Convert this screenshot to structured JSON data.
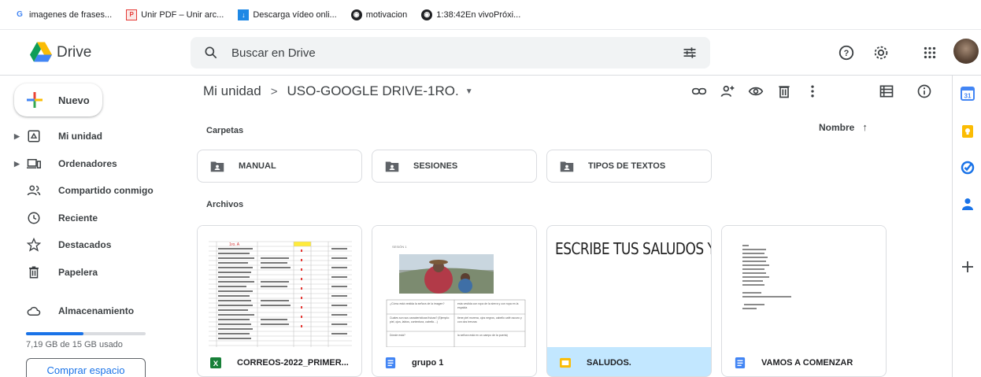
{
  "bookmarks": [
    {
      "label": "imagenes de frases...",
      "icon": "google-g-icon"
    },
    {
      "label": "Unir PDF – Unir arc...",
      "icon": "pdf-icon"
    },
    {
      "label": "Descarga vídeo onli...",
      "icon": "download-icon"
    },
    {
      "label": "motivacion",
      "icon": "globe-icon"
    },
    {
      "label": "1:38:42En vivoPróxi...",
      "icon": "globe-icon"
    }
  ],
  "header": {
    "app_name": "Drive",
    "search_placeholder": "Buscar en Drive"
  },
  "sidebar": {
    "new_label": "Nuevo",
    "items": [
      {
        "label": "Mi unidad",
        "icon": "drive-icon"
      },
      {
        "label": "Ordenadores",
        "icon": "computer-icon"
      },
      {
        "label": "Compartido conmigo",
        "icon": "people-icon"
      },
      {
        "label": "Reciente",
        "icon": "clock-icon"
      },
      {
        "label": "Destacados",
        "icon": "star-icon"
      },
      {
        "label": "Papelera",
        "icon": "trash-icon"
      },
      {
        "label": "Almacenamiento",
        "icon": "cloud-icon"
      }
    ],
    "storage_text": "7,19 GB de 15 GB usado",
    "storage_fraction": 0.48,
    "buy_label": "Comprar espacio"
  },
  "main": {
    "breadcrumb_root": "Mi unidad",
    "breadcrumb_sep": ">",
    "breadcrumb_current": "USO-GOOGLE DRIVE-1RO.",
    "folders_heading": "Carpetas",
    "files_heading": "Archivos",
    "sort_label": "Nombre",
    "sort_arrow": "↑",
    "folders": [
      {
        "name": "MANUAL"
      },
      {
        "name": "SESIONES"
      },
      {
        "name": "TIPOS DE TEXTOS"
      }
    ],
    "files": [
      {
        "name": "CORREOS-2022_PRIMER...",
        "type": "sheets",
        "icon": "sheets-icon"
      },
      {
        "name": "grupo 1",
        "type": "docs",
        "icon": "docs-icon"
      },
      {
        "name": "SALUDOS.",
        "type": "slides",
        "icon": "slides-icon",
        "selected": true,
        "preview_text": "ESCRIBE TUS SALUDOS Y Q"
      },
      {
        "name": "VAMOS A COMENZAR",
        "type": "docs",
        "icon": "docs-icon"
      }
    ],
    "doc_preview": {
      "title": "SESIÓN 1",
      "q1": "¿Cómo está vestida la señora de la imagen?",
      "a1": "esta vestida con ropa de la sierra y con ropa en la espalda",
      "q2": "Cuales son sus características físicas? (Ejemplo: piel, ojos, labios, contextura, cabello…)",
      "a2": "tiene piel morena, ojos negros, cabello café oscuro y con dos trenzas",
      "q3": "Dónde está?",
      "a3": "la señora está en un campo de la puerta)"
    }
  },
  "colors": {
    "blue": "#1a73e8",
    "selected_bg": "#c2e7ff",
    "sheets_green": "#188038",
    "docs_blue": "#4285f4",
    "slides_yellow": "#fbbc04"
  }
}
